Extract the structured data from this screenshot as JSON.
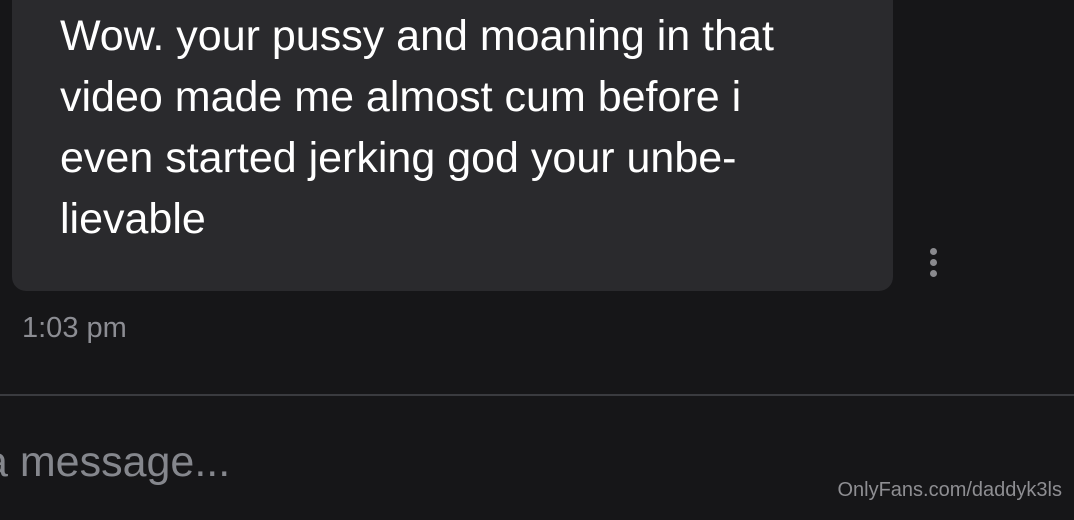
{
  "message": {
    "text": "Wow. your pussy and moaning in that\nvideo made me almost cum before i\neven started jerking god your unbe-\nlievable",
    "timestamp": "1:03 pm",
    "more_icon": "vertical-dots-icon"
  },
  "composer": {
    "placeholder": "a message..."
  },
  "watermark": "OnlyFans.com/daddyk3ls",
  "colors": {
    "background": "#161618",
    "bubble": "#2a2a2d",
    "text": "#ffffff",
    "muted": "#8c8d93"
  }
}
